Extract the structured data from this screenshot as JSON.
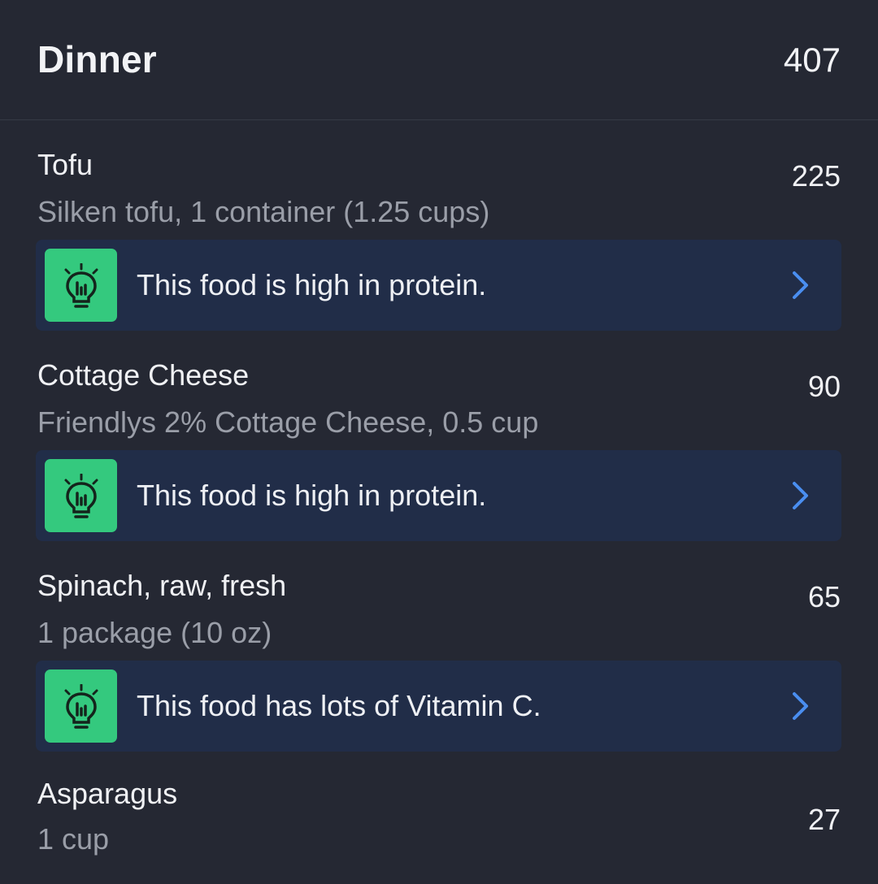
{
  "meal": {
    "title": "Dinner",
    "total_calories": "407"
  },
  "foods": [
    {
      "name": "Tofu",
      "description": "Silken tofu, 1 container (1.25 cups)",
      "calories": "225",
      "insight": "This food is high in protein."
    },
    {
      "name": "Cottage Cheese",
      "description": "Friendlys 2% Cottage Cheese, 0.5 cup",
      "calories": "90",
      "insight": "This food is high in protein."
    },
    {
      "name": "Spinach, raw, fresh",
      "description": "1 package (10 oz)",
      "calories": "65",
      "insight": "This food has lots of Vitamin C."
    },
    {
      "name": "Asparagus",
      "description": "1 cup",
      "calories": "27"
    }
  ],
  "icons": {
    "insight": "lightbulb-chart-icon",
    "open": "chevron-right-icon"
  },
  "colors": {
    "background": "#252833",
    "insight_card": "#212d48",
    "icon_badge": "#34c97e",
    "chevron": "#4a8ef0",
    "secondary_text": "#9a9ea8"
  }
}
